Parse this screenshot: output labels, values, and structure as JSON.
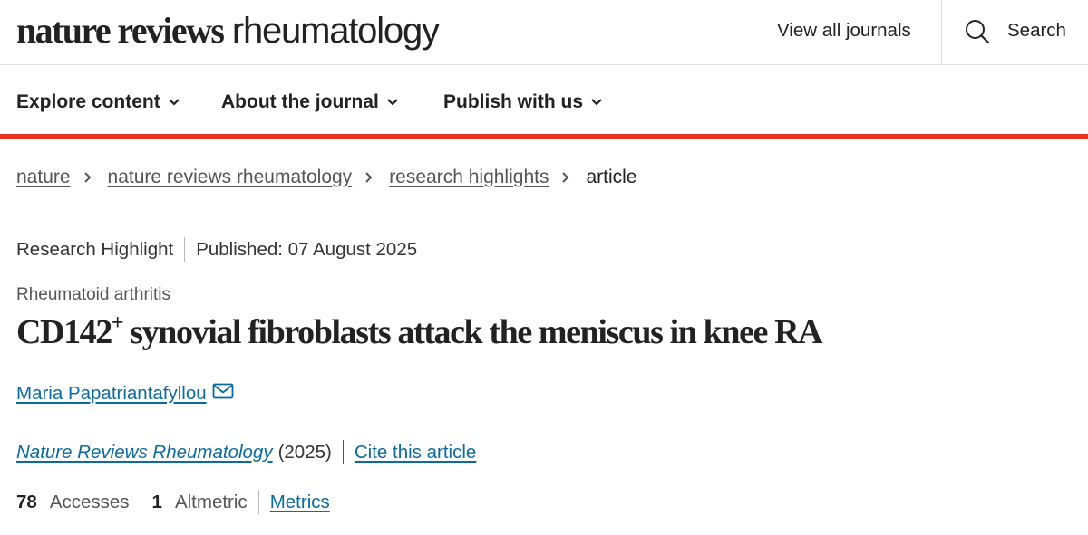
{
  "header": {
    "logo_bold": "nature reviews",
    "logo_light": "rheumatology",
    "view_all": "View all journals",
    "search_label": "Search",
    "search_icon": "magnifier"
  },
  "menu": {
    "items": [
      {
        "label": "Explore content"
      },
      {
        "label": "About the journal"
      },
      {
        "label": "Publish with us"
      }
    ],
    "accent_color": "#e5311d"
  },
  "breadcrumb": {
    "items": [
      "nature",
      "nature reviews rheumatology",
      "research highlights"
    ],
    "current": "article"
  },
  "article": {
    "type": "Research Highlight",
    "published": "Published: 07 August 2025",
    "subject": "Rheumatoid arthritis",
    "title_prefix": "CD142",
    "title_sup": "+",
    "title_rest": " synovial fibroblasts attack the meniscus in knee RA",
    "author": "Maria Papatriantafyllou",
    "journal": "Nature Reviews Rheumatology",
    "year": "(2025)",
    "cite": "Cite this article",
    "link_color": "#0c6aa3"
  },
  "metrics": {
    "accesses_count": "78",
    "accesses_label": "Accesses",
    "altmetric_count": "1",
    "altmetric_label": "Altmetric",
    "metrics_link": "Metrics"
  }
}
